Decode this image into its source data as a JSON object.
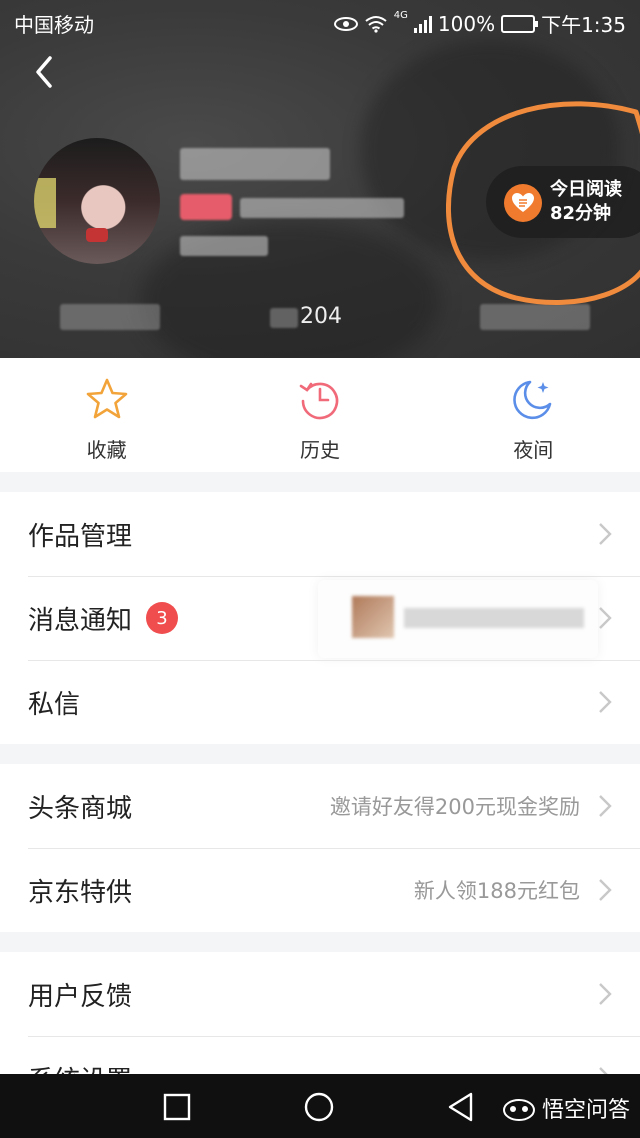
{
  "status_bar": {
    "carrier": "中国移动",
    "network": "4G",
    "battery": "100%",
    "time": "下午1:35"
  },
  "header": {
    "stat_value": "204",
    "reading": {
      "line1": "今日阅读",
      "line2": "82分钟"
    }
  },
  "quick_actions": [
    {
      "label": "收藏",
      "icon": "star-icon"
    },
    {
      "label": "历史",
      "icon": "history-clock-icon"
    },
    {
      "label": "夜间",
      "icon": "moon-icon"
    }
  ],
  "menu": {
    "works": "作品管理",
    "notifications": "消息通知",
    "notifications_badge": "3",
    "private_message": "私信",
    "mall": "头条商城",
    "mall_sub": "邀请好友得200元现金奖励",
    "jd": "京东特供",
    "jd_sub": "新人领188元红包",
    "feedback": "用户反馈",
    "settings": "系统设置"
  },
  "watermark": "悟空问答",
  "colors": {
    "accent_orange": "#f07b2e",
    "badge_red": "#f04e4e",
    "annotation": "#f08a3c"
  }
}
